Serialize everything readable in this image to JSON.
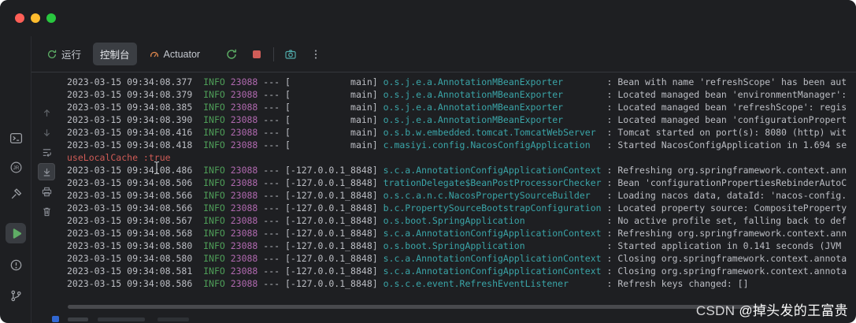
{
  "titlebar": {
    "buttons": [
      "close",
      "minimize",
      "zoom"
    ]
  },
  "run_header": {
    "tabs": [
      {
        "label": "运行",
        "icon": "rerun-icon",
        "selected": false
      },
      {
        "label": "控制台",
        "icon": null,
        "selected": true
      },
      {
        "label": "Actuator",
        "icon": "actuator-gauge-icon",
        "selected": false
      }
    ],
    "actions": [
      {
        "name": "rerun",
        "color": "#5fb368"
      },
      {
        "name": "stop",
        "color": "#cf5d58"
      },
      {
        "name": "thread-dump",
        "color": "#4fa8a8"
      },
      {
        "name": "more-options",
        "color": "#9da0a6"
      }
    ]
  },
  "left_stripe": {
    "items": [
      "terminal",
      "jrebel",
      "build-tool",
      "run",
      "problems",
      "git-branch"
    ],
    "selected": "run"
  },
  "console_toolbar": {
    "items": [
      "scroll-up",
      "scroll-down",
      "soft-wrap",
      "scroll-to-end",
      "print",
      "clear-all"
    ],
    "toggled": "scroll-to-end"
  },
  "console": {
    "colors": {
      "default": "#bcbec4",
      "info_level": "#4e9e58",
      "pid": "#b069af",
      "logger": "#3aa5a8",
      "error": "#cf5b56"
    },
    "lines": [
      {
        "time": "2023-03-15 09:34:08.377",
        "level": "INFO",
        "pid": "23088",
        "thread": "main",
        "logger": "o.s.j.e.a.AnnotationMBeanExporter",
        "msg": "Bean with name 'refreshScope' has been aut"
      },
      {
        "time": "2023-03-15 09:34:08.379",
        "level": "INFO",
        "pid": "23088",
        "thread": "main",
        "logger": "o.s.j.e.a.AnnotationMBeanExporter",
        "msg": "Located managed bean 'environmentManager':"
      },
      {
        "time": "2023-03-15 09:34:08.385",
        "level": "INFO",
        "pid": "23088",
        "thread": "main",
        "logger": "o.s.j.e.a.AnnotationMBeanExporter",
        "msg": "Located managed bean 'refreshScope': regis"
      },
      {
        "time": "2023-03-15 09:34:08.390",
        "level": "INFO",
        "pid": "23088",
        "thread": "main",
        "logger": "o.s.j.e.a.AnnotationMBeanExporter",
        "msg": "Located managed bean 'configurationPropert"
      },
      {
        "time": "2023-03-15 09:34:08.416",
        "level": "INFO",
        "pid": "23088",
        "thread": "main",
        "logger": "o.s.b.w.embedded.tomcat.TomcatWebServer",
        "msg": "Tomcat started on port(s): 8080 (http) wit"
      },
      {
        "time": "2023-03-15 09:34:08.418",
        "level": "INFO",
        "pid": "23088",
        "thread": "main",
        "logger": "c.masiyi.config.NacosConfigApplication",
        "msg": "Started NacosConfigApplication in 1.694 se"
      },
      {
        "error": "useLocalCache :true"
      },
      {
        "time": "2023-03-15 09:34:08.486",
        "level": "INFO",
        "pid": "23088",
        "thread": "-127.0.0.1_8848",
        "logger": "s.c.a.AnnotationConfigApplicationContext",
        "msg": "Refreshing org.springframework.context.ann"
      },
      {
        "time": "2023-03-15 09:34:08.506",
        "level": "INFO",
        "pid": "23088",
        "thread": "-127.0.0.1_8848",
        "logger": "trationDelegate$BeanPostProcessorChecker",
        "msg": "Bean 'configurationPropertiesRebinderAutoC"
      },
      {
        "time": "2023-03-15 09:34:08.566",
        "level": "INFO",
        "pid": "23088",
        "thread": "-127.0.0.1_8848",
        "logger": "o.s.c.a.n.c.NacosPropertySourceBuilder",
        "msg": "Loading nacos data, dataId: 'nacos-config."
      },
      {
        "time": "2023-03-15 09:34:08.566",
        "level": "INFO",
        "pid": "23088",
        "thread": "-127.0.0.1_8848",
        "logger": "b.c.PropertySourceBootstrapConfiguration",
        "msg": "Located property source: CompositeProperty"
      },
      {
        "time": "2023-03-15 09:34:08.567",
        "level": "INFO",
        "pid": "23088",
        "thread": "-127.0.0.1_8848",
        "logger": "o.s.boot.SpringApplication",
        "msg": "No active profile set, falling back to def"
      },
      {
        "time": "2023-03-15 09:34:08.568",
        "level": "INFO",
        "pid": "23088",
        "thread": "-127.0.0.1_8848",
        "logger": "s.c.a.AnnotationConfigApplicationContext",
        "msg": "Refreshing org.springframework.context.ann"
      },
      {
        "time": "2023-03-15 09:34:08.580",
        "level": "INFO",
        "pid": "23088",
        "thread": "-127.0.0.1_8848",
        "logger": "o.s.boot.SpringApplication",
        "msg": "Started application in 0.141 seconds (JVM"
      },
      {
        "time": "2023-03-15 09:34:08.580",
        "level": "INFO",
        "pid": "23088",
        "thread": "-127.0.0.1_8848",
        "logger": "s.c.a.AnnotationConfigApplicationContext",
        "msg": "Closing org.springframework.context.annota"
      },
      {
        "time": "2023-03-15 09:34:08.581",
        "level": "INFO",
        "pid": "23088",
        "thread": "-127.0.0.1_8848",
        "logger": "s.c.a.AnnotationConfigApplicationContext",
        "msg": "Closing org.springframework.context.annota"
      },
      {
        "time": "2023-03-15 09:34:08.586",
        "level": "INFO",
        "pid": "23088",
        "thread": "-127.0.0.1_8848",
        "logger": "o.s.c.e.event.RefreshEventListener",
        "msg": "Refresh keys changed: []"
      }
    ]
  },
  "watermark": {
    "brand": "CSDN ",
    "author": "@掉头发的王富贵"
  }
}
